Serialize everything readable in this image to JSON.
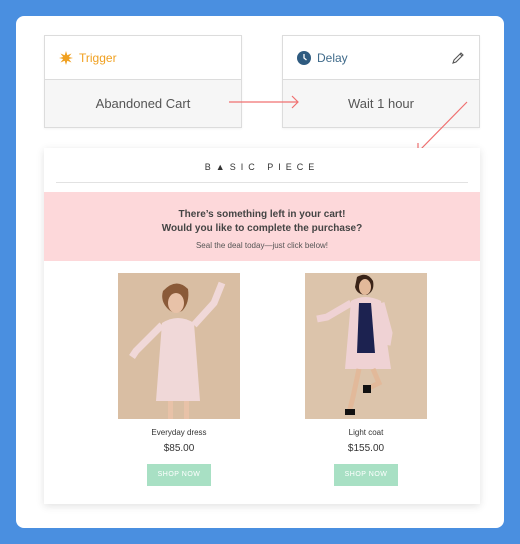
{
  "trigger": {
    "label": "Trigger",
    "body": "Abandoned Cart"
  },
  "delay": {
    "label": "Delay",
    "body": "Wait 1 hour"
  },
  "email": {
    "brand": "B▲SIC PIECE",
    "headline_line1": "There’s something left in your cart!",
    "headline_line2": "Would you like to complete the purchase?",
    "subtext": "Seal the deal today—just click below!",
    "products": [
      {
        "name": "Everyday dress",
        "price": "$85.00",
        "button": "SHOP NOW"
      },
      {
        "name": "Light coat",
        "price": "$155.00",
        "button": "SHOP NOW"
      }
    ]
  },
  "colors": {
    "background": "#4a8fe0",
    "trigger_accent": "#f0a020",
    "delay_accent": "#3f6a8a",
    "arrow": "#f07070",
    "promo_bg": "#fdd8da",
    "button_bg": "#a8e0c4"
  },
  "icons": {
    "trigger": "starburst-icon",
    "delay": "clock-icon",
    "edit": "pencil-icon"
  }
}
